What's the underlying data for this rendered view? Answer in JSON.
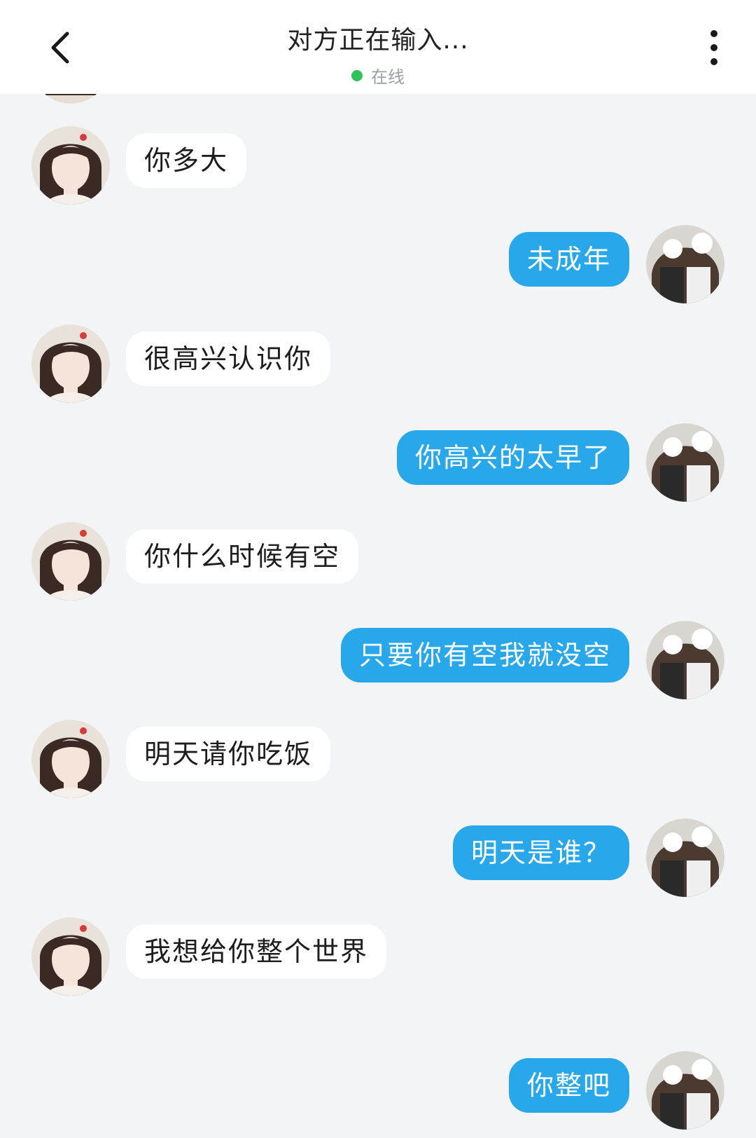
{
  "header": {
    "title": "对方正在输入...",
    "status": "在线",
    "status_color": "#2fc25b",
    "back_icon": "chevron-left-icon",
    "more_icon": "more-vertical-icon"
  },
  "messages": [
    {
      "side": "left",
      "text": "你多大"
    },
    {
      "side": "right",
      "text": "未成年"
    },
    {
      "side": "left",
      "text": "很高兴认识你"
    },
    {
      "side": "right",
      "text": "你高兴的太早了"
    },
    {
      "side": "left",
      "text": "你什么时候有空"
    },
    {
      "side": "right",
      "text": "只要你有空我就没空"
    },
    {
      "side": "left",
      "text": "明天请你吃饭"
    },
    {
      "side": "right",
      "text": "明天是谁？"
    },
    {
      "side": "left",
      "text": "我想给你整个世界"
    },
    {
      "side": "right",
      "text": "你整吧"
    }
  ],
  "colors": {
    "outgoing_bubble": "#28a8ea",
    "incoming_bubble": "#ffffff",
    "background": "#f3f4f6"
  }
}
